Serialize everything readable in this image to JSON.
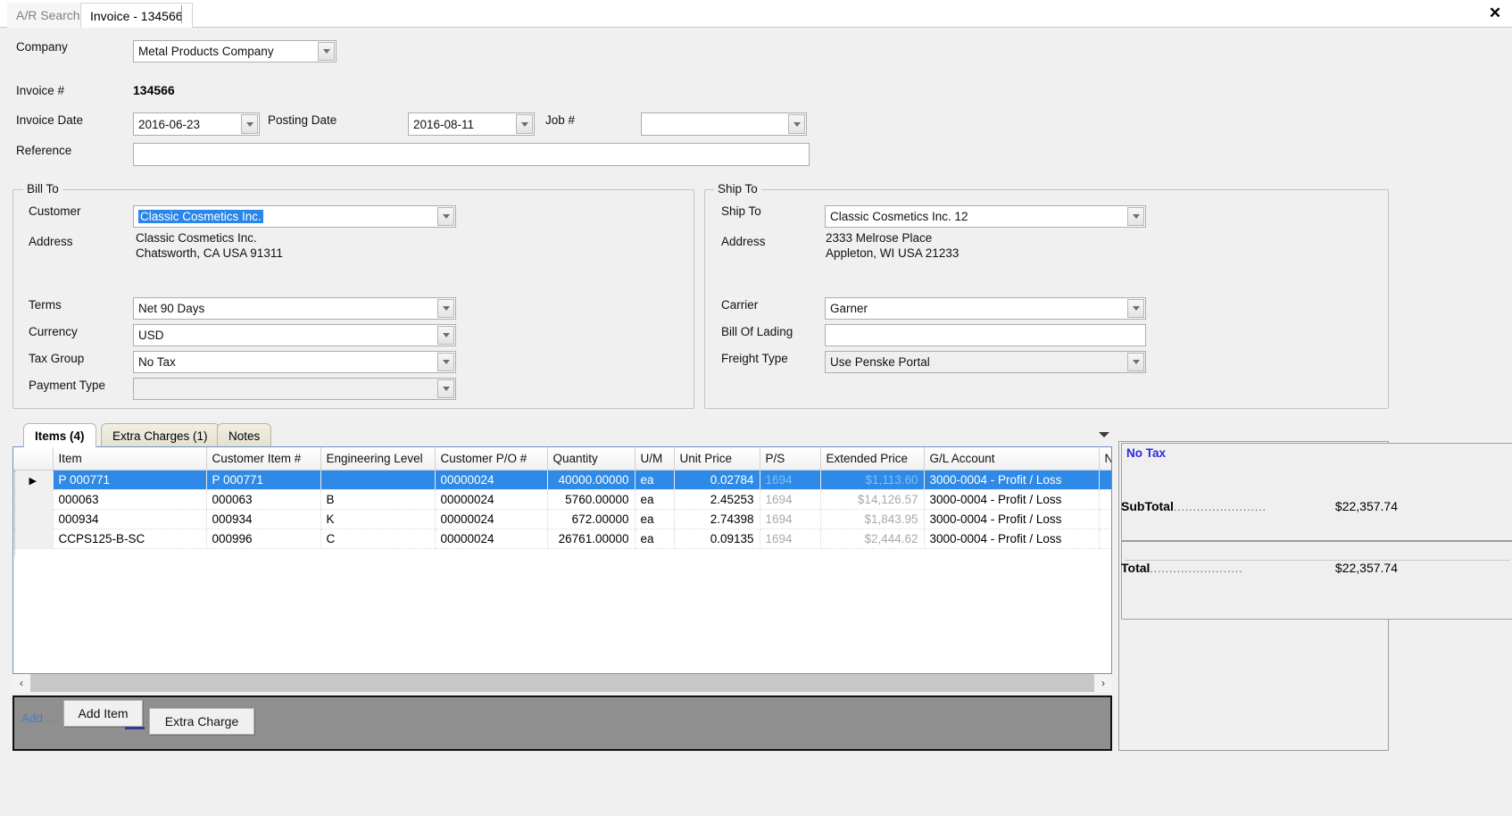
{
  "window": {
    "close_label": "✕"
  },
  "tabs": [
    {
      "label": "A/R Search",
      "active": false
    },
    {
      "label": "Invoice - 134566",
      "active": true
    }
  ],
  "header": {
    "company_label": "Company",
    "company_value": "Metal Products Company",
    "invoice_no_label": "Invoice #",
    "invoice_no_value": "134566",
    "invoice_date_label": "Invoice Date",
    "invoice_date_value": "2016-06-23",
    "posting_date_label": "Posting Date",
    "posting_date_value": "2016-08-11",
    "job_label": "Job #",
    "job_value": "",
    "reference_label": "Reference",
    "reference_value": ""
  },
  "bill_to": {
    "title": "Bill To",
    "customer_label": "Customer",
    "customer_value": "Classic Cosmetics Inc.",
    "customer_selected": true,
    "address_label": "Address",
    "address_value": "Classic Cosmetics Inc.\nChatsworth, CA USA 91311",
    "terms_label": "Terms",
    "terms_value": "Net 90 Days",
    "currency_label": "Currency",
    "currency_value": "USD",
    "tax_group_label": "Tax Group",
    "tax_group_value": "No Tax",
    "payment_type_label": "Payment Type",
    "payment_type_value": ""
  },
  "ship_to": {
    "title": "Ship To",
    "ship_to_label": "Ship To",
    "ship_to_value": "Classic Cosmetics Inc. 12",
    "address_label": "Address",
    "address_value": "2333 Melrose Place\nAppleton, WI USA 21233",
    "carrier_label": "Carrier",
    "carrier_value": "Garner",
    "bol_label": "Bill Of Lading",
    "bol_value": "",
    "freight_type_label": "Freight Type",
    "freight_type_value": "Use Penske Portal"
  },
  "items_panel": {
    "tabs": [
      {
        "label": "Items (4)",
        "selected": true
      },
      {
        "label": "Extra Charges (1)",
        "selected": false
      },
      {
        "label": "Notes",
        "selected": false
      }
    ],
    "columns": [
      "Item",
      "Customer Item #",
      "Engineering Level",
      "Customer P/O #",
      "Quantity",
      "U/M",
      "Unit Price",
      "P/S",
      "Extended Price",
      "G/L Account",
      "N"
    ],
    "rows": [
      {
        "selected": true,
        "item": "P 000771",
        "customer_item": "P 000771",
        "engineering_level": "",
        "customer_po": "00000024",
        "quantity": "40000.00000",
        "um": "ea",
        "unit_price": "0.02784",
        "ps": "1694",
        "extended_price": "$1,113.60",
        "gl_account": "3000-0004 - Profit / Loss"
      },
      {
        "selected": false,
        "item": "000063",
        "customer_item": "000063",
        "engineering_level": "B",
        "customer_po": "00000024",
        "quantity": "5760.00000",
        "um": "ea",
        "unit_price": "2.45253",
        "ps": "1694",
        "extended_price": "$14,126.57",
        "gl_account": "3000-0004 - Profit / Loss"
      },
      {
        "selected": false,
        "item": "000934",
        "customer_item": "000934",
        "engineering_level": "K",
        "customer_po": "00000024",
        "quantity": "672.00000",
        "um": "ea",
        "unit_price": "2.74398",
        "ps": "1694",
        "extended_price": "$1,843.95",
        "gl_account": "3000-0004 - Profit / Loss"
      },
      {
        "selected": false,
        "item": "CCPS125-B-SC",
        "customer_item": "000996",
        "engineering_level": "C",
        "customer_po": "00000024",
        "quantity": "26761.00000",
        "um": "ea",
        "unit_price": "0.09135",
        "ps": "1694",
        "extended_price": "$2,444.62",
        "gl_account": "3000-0004 - Profit / Loss"
      }
    ]
  },
  "action_bar": {
    "add_link": "Add ...",
    "add_item_label": "Add Item",
    "extra_charge_label": "Extra Charge"
  },
  "totals": {
    "tax_note": "No Tax",
    "subtotal_label": "SubTotal",
    "subtotal_value": "$22,357.74",
    "total_label": "Total",
    "total_value": "$22,357.74",
    "dots": "........................"
  },
  "colors": {
    "selection_blue": "#2e8ae6",
    "link_blue": "#4a7ebb",
    "tax_note_blue": "#2a2ae0",
    "grid_border": "#6b93c4"
  }
}
